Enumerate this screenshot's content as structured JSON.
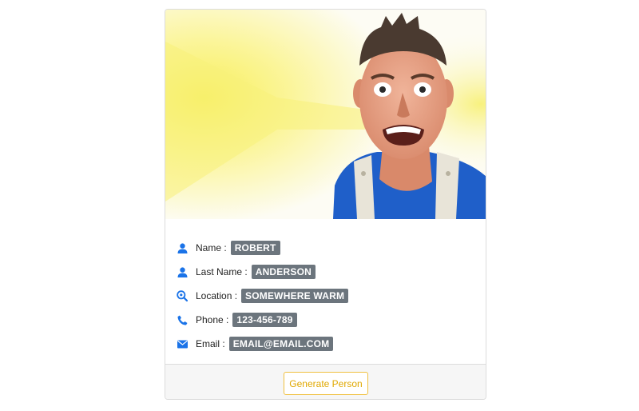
{
  "person": {
    "fields": [
      {
        "label": "Name :",
        "value": "ROBERT",
        "icon": "user-icon"
      },
      {
        "label": "Last Name :",
        "value": "ANDERSON",
        "icon": "user-icon"
      },
      {
        "label": "Location :",
        "value": "SOMEWHERE WARM",
        "icon": "search-location-icon"
      },
      {
        "label": "Phone :",
        "value": "123-456-789",
        "icon": "phone-icon"
      },
      {
        "label": "Email :",
        "value": "EMAIL@EMAIL.COM",
        "icon": "envelope-icon"
      }
    ]
  },
  "actions": {
    "generate_label": "Generate Person"
  },
  "colors": {
    "icon": "#1a73e8",
    "badge": "#6c757d",
    "button_border": "#f0c040",
    "button_text": "#e0a800",
    "footer_bg": "#f6f6f6"
  }
}
